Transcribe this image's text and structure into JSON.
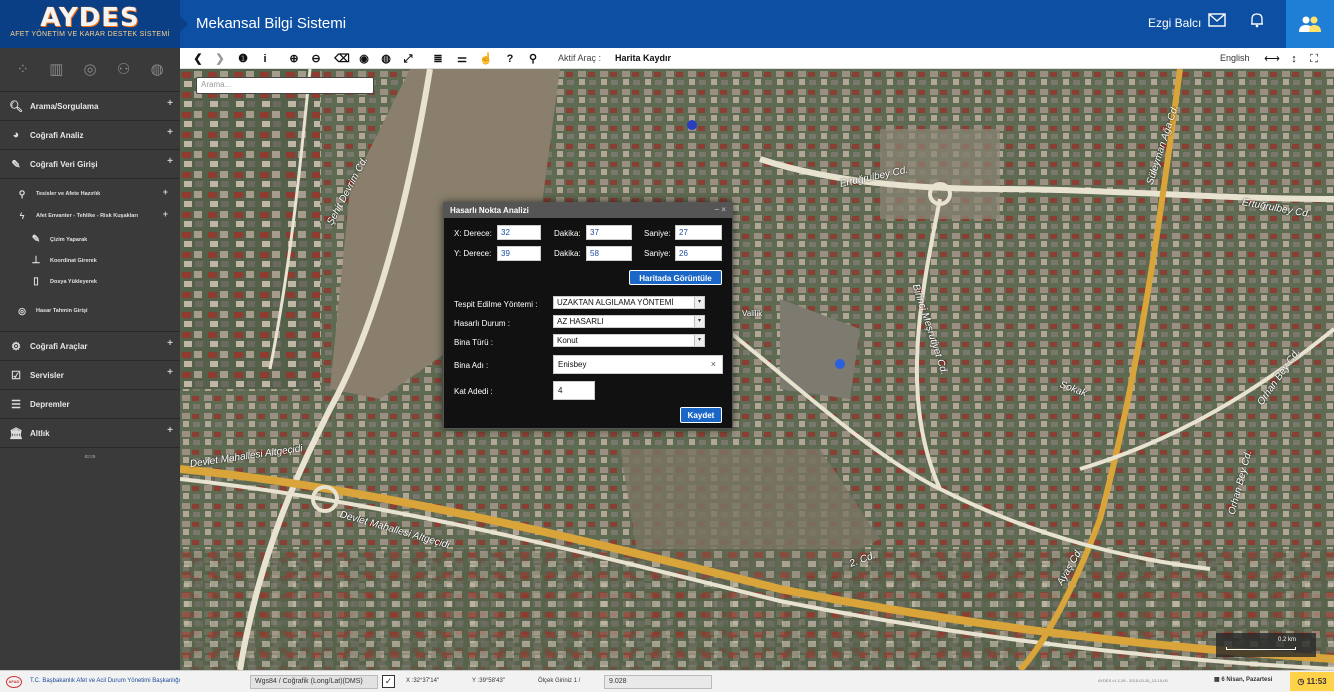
{
  "header": {
    "logo_text": "AYDES",
    "logo_subtitle": "AFET YÖNETİM VE KARAR DESTEK SİSTEMİ",
    "app_title": "Mekansal Bilgi Sistemi",
    "user_name": "Ezgi Balcı",
    "colors": {
      "header": "#0d4fa3",
      "logo_bg": "#0a3f85",
      "profile": "#1f7fd6"
    },
    "icons": [
      "mail-icon",
      "bell-icon",
      "users-icon"
    ]
  },
  "sidebar": {
    "tool_icons": [
      "layers-tree-icon",
      "chart-icon",
      "database-icon",
      "network-icon",
      "globe-icon"
    ],
    "menu": [
      {
        "label": "Arama/Sorgulama",
        "icon": "search-icon",
        "glyph": "🔍︎"
      },
      {
        "label": "Coğrafi Analiz",
        "icon": "pie-chart-icon",
        "glyph": "◕"
      },
      {
        "label": "Coğrafi Veri Girişi",
        "icon": "edit-icon",
        "glyph": "✎"
      }
    ],
    "sub_items": [
      {
        "label": "Tesisler ve Afete Hazırlık",
        "icon": "map-marker-icon",
        "glyph": "⚲"
      },
      {
        "label": "Afet Envanter - Tehlike - Risk Kuşakları",
        "icon": "flash-icon",
        "glyph": "ϟ"
      }
    ],
    "subsub_items": [
      {
        "label": "Çizim Yaparak",
        "icon": "pencil-square-icon",
        "glyph": "✎"
      },
      {
        "label": "Koordinat Girerek",
        "icon": "pin-icon",
        "glyph": "⊥"
      },
      {
        "label": "Dosya Yükleyerek",
        "icon": "file-icon",
        "glyph": "▯"
      }
    ],
    "extra_item": {
      "label": "Hasar Tahmin Girişi",
      "icon": "target-icon",
      "glyph": "◎"
    },
    "menu2": [
      {
        "label": "Coğrafi Araçlar",
        "icon": "cogs-icon",
        "glyph": "⚙"
      },
      {
        "label": "Servisler",
        "icon": "check-square-icon",
        "glyph": "☑"
      },
      {
        "label": "Depremler",
        "icon": "list-icon",
        "glyph": "☰"
      },
      {
        "label": "Altlık",
        "icon": "bank-icon",
        "glyph": "🏛︎"
      }
    ],
    "plus": "+",
    "collapse": "⟺"
  },
  "toolbar": {
    "tools": [
      {
        "name": "back-icon",
        "glyph": "❮"
      },
      {
        "name": "forward-icon",
        "glyph": "❯"
      },
      {
        "name": "info-circle-icon",
        "glyph": "❶"
      },
      {
        "name": "info-icon",
        "glyph": "i"
      },
      {
        "name": "zoom-in-icon",
        "glyph": "⊕"
      },
      {
        "name": "zoom-out-icon",
        "glyph": "⊖"
      },
      {
        "name": "eraser-icon",
        "glyph": "⌫"
      },
      {
        "name": "eye-icon",
        "glyph": "◉"
      },
      {
        "name": "globe-icon",
        "glyph": "◍"
      },
      {
        "name": "fullscreen-icon",
        "glyph": "⤢"
      },
      {
        "name": "list-icon",
        "glyph": "≣"
      },
      {
        "name": "sliders-icon",
        "glyph": "⚌"
      },
      {
        "name": "hand-icon",
        "glyph": "☝"
      },
      {
        "name": "help-icon",
        "glyph": "?"
      },
      {
        "name": "marker-icon",
        "glyph": "⚲"
      }
    ],
    "active_tool_label": "Aktif Araç :",
    "active_tool_value": "Harita Kaydır",
    "language": "English",
    "right_icons": [
      {
        "name": "horizontal-resize-icon",
        "glyph": "⟷"
      },
      {
        "name": "vertical-resize-icon",
        "glyph": "↕"
      },
      {
        "name": "expand-icon",
        "glyph": "⛶"
      }
    ]
  },
  "map": {
    "search_placeholder": "Arama...",
    "street_labels": [
      "Şehit Devrim Cd.",
      "Ertuğrulbey Cd.",
      "Ertuğrulbey Cd.",
      "Süleyman Ağa Cd.",
      "Birinci Meşrutiyet Cd.",
      "Orhan Bey Cd.",
      "Orhan Bey Cd.",
      "Devlet Mahallesi Altgeçidi",
      "Devlet Mahallesi Altgeçidi",
      "Ayaş Cd.",
      "2. Cd.",
      "Sokak",
      "Valilik"
    ],
    "scale_label": "0.2 km"
  },
  "dialog": {
    "title": "Hasarlı Nokta Analizi",
    "x_derece_label": "X: Derece:",
    "x_derece": "32",
    "x_dakika_label": "Dakika:",
    "x_dakika": "37",
    "x_saniye_label": "Saniye:",
    "x_saniye": "27",
    "y_derece_label": "Y: Derece:",
    "y_derece": "39",
    "y_dakika_label": "Dakika:",
    "y_dakika": "58",
    "y_saniye_label": "Saniye:",
    "y_saniye": "26",
    "show_on_map": "Haritada Görüntüle",
    "method_label": "Tespit Edilme Yöntemi :",
    "method_value": "UZAKTAN ALGILAMA YÖNTEMİ",
    "damage_label": "Hasarlı Durum :",
    "damage_value": "AZ HASARLI",
    "type_label": "Bina Türü :",
    "type_value": "Konut",
    "name_label": "Bina Adı :",
    "name_value": "Enisbey",
    "floor_label": "Kat Adedi :",
    "floor_value": "4",
    "save": "Kaydet",
    "controls": "− ×",
    "select_arrow": "▾",
    "clear_x": "×"
  },
  "status": {
    "org": "T.C. Başbakanlık Afet ve Acil Durum Yönetimi Başkanlığı",
    "org_logo": "AFAD",
    "projection": "Wgs84 / Coğrafik (Long/Lat)(DMS)",
    "checkbox_glyph": "✓",
    "x_coord": "X :32°37'14\"",
    "y_coord": "Y :39°58'43\"",
    "scale_label": "Ölçek Giriniz 1 /",
    "scale_value": "9.028",
    "version": "AYDES v1.1.28 - 2015-03-30_13-15-00",
    "date": "6 Nisan, Pazartesi",
    "time": "11:53"
  }
}
